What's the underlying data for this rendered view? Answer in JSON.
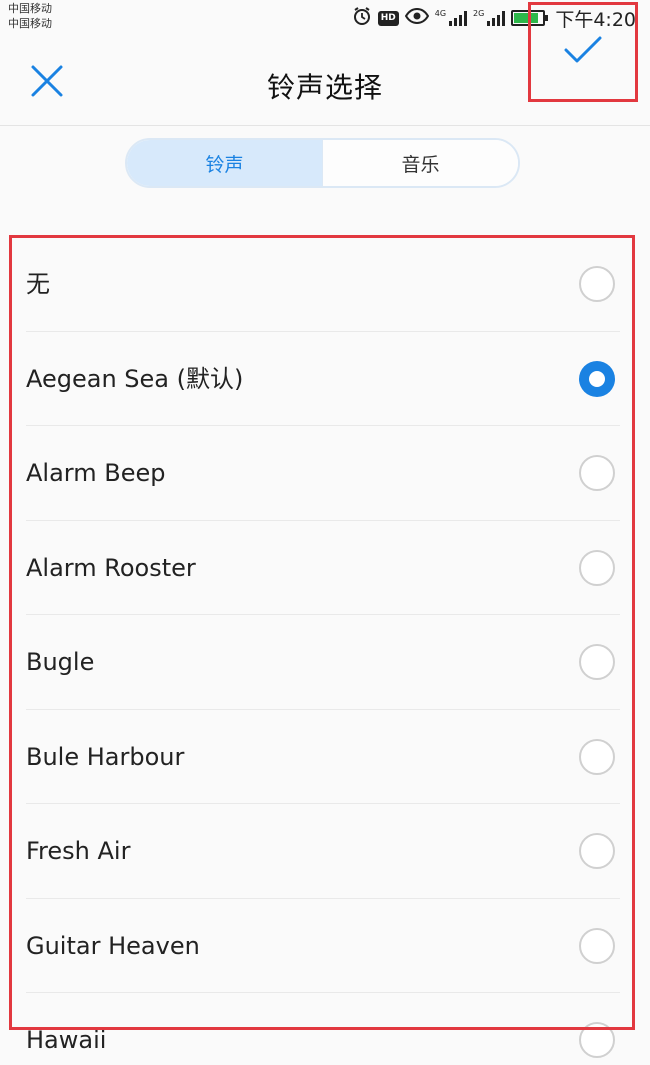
{
  "status_bar": {
    "carrier_1": "中国移动",
    "carrier_2": "中国移动",
    "hd_label": "HD",
    "signal_1_tag": "4G",
    "signal_2_tag": "2G",
    "battery_level": 0.85,
    "time": "下午4:20",
    "icons": [
      "alarm-icon",
      "hd-icon",
      "eye-icon",
      "signal-icon",
      "signal-icon",
      "battery-icon"
    ]
  },
  "header": {
    "title": "铃声选择",
    "close_icon": "close-icon",
    "confirm_icon": "check-icon"
  },
  "tabs": [
    {
      "label": "铃声",
      "active": true
    },
    {
      "label": "音乐",
      "active": false
    }
  ],
  "ringtones": [
    {
      "label": "无",
      "selected": false
    },
    {
      "label": "Aegean Sea (默认)",
      "selected": true
    },
    {
      "label": "Alarm Beep",
      "selected": false
    },
    {
      "label": "Alarm Rooster",
      "selected": false
    },
    {
      "label": "Bugle",
      "selected": false
    },
    {
      "label": "Bule Harbour",
      "selected": false
    },
    {
      "label": "Fresh Air",
      "selected": false
    },
    {
      "label": "Guitar Heaven",
      "selected": false
    },
    {
      "label": "Hawaii",
      "selected": false
    }
  ],
  "colors": {
    "accent": "#1a82e2",
    "highlight": "#e2383f",
    "battery": "#2db84a"
  }
}
